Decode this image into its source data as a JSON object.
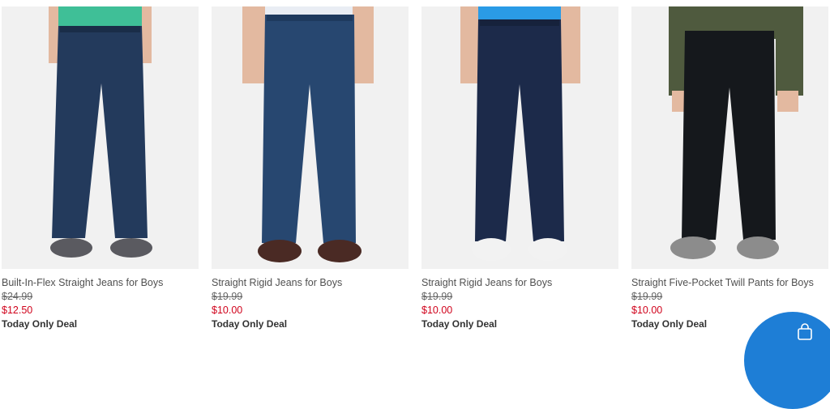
{
  "products": [
    {
      "title": "Built-In-Flex Straight Jeans for Boys",
      "original_price": "$24.99",
      "sale_price": "$12.50",
      "deal": "Today Only Deal",
      "shirt": "#3fbf97",
      "denim": "#233a5c",
      "shoe": "#5a5a60"
    },
    {
      "title": "Straight Rigid Jeans for Boys",
      "original_price": "$19.99",
      "sale_price": "$10.00",
      "deal": "Today Only Deal",
      "shirt": "#e9edf4",
      "denim": "#274770",
      "shoe": "#4a2a24"
    },
    {
      "title": "Straight Rigid Jeans for Boys",
      "original_price": "$19.99",
      "sale_price": "$10.00",
      "deal": "Today Only Deal",
      "shirt": "#2a9be6",
      "denim": "#1c2a4a",
      "shoe": "#f2f2f2"
    },
    {
      "title": "Straight Five-Pocket Twill Pants for Boys",
      "original_price": "$19.99",
      "sale_price": "$10.00",
      "deal": "Today Only Deal",
      "shirt": "#4f5a3e",
      "denim": "#15181c",
      "shoe": "#8c8c8c"
    }
  ],
  "colors": {
    "sale": "#d0021b",
    "fab": "#1e7ed6"
  },
  "fab": {
    "icon": "shopping-bag-icon"
  }
}
